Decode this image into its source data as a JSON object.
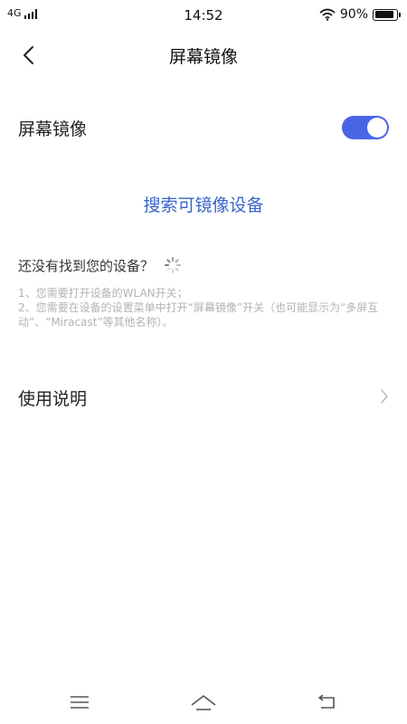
{
  "status_bar": {
    "network": "4G",
    "time": "14:52",
    "battery": "90%",
    "battery_level": 0.9
  },
  "header": {
    "title": "屏幕镜像",
    "back_icon": "back-arrow-icon"
  },
  "mirror_row": {
    "label": "屏幕镜像",
    "toggle_on": true,
    "accent": "#4a64e6"
  },
  "search": {
    "label": "搜索可镜像设备",
    "color": "#3a63c9"
  },
  "not_found": {
    "label": "还没有找到您的设备？",
    "hint": "1、您需要打开设备的WLAN开关；\n2、您需要在设备的设置菜单中打开“屏幕镜像”开关（也可能显示为“多屏互动”、“Miracast”等其他名称）。"
  },
  "usage_row": {
    "label": "使用说明"
  },
  "nav_bar": {
    "menu_icon": "menu-icon",
    "home_icon": "home-icon",
    "back_icon": "back-icon"
  }
}
